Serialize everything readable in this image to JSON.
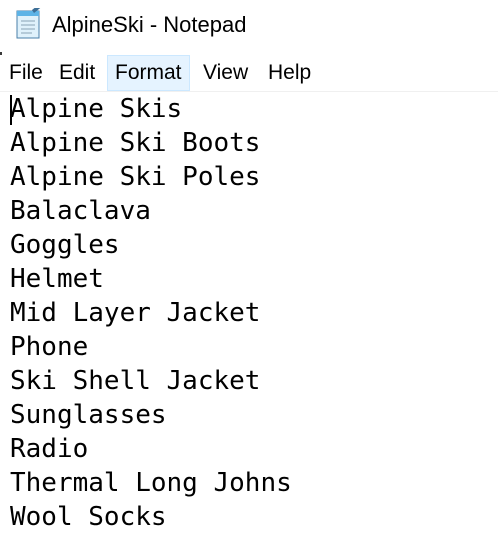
{
  "window": {
    "title": "AlpineSki - Notepad",
    "icon": "notepad-icon"
  },
  "menu": {
    "file": "File",
    "edit": "Edit",
    "format": "Format",
    "view": "View",
    "help": "Help"
  },
  "document": {
    "lines": [
      "Alpine Skis",
      "Alpine Ski Boots",
      "Alpine Ski Poles",
      "Balaclava",
      "Goggles",
      "Helmet",
      "Mid Layer Jacket",
      "Phone",
      "Ski Shell Jacket",
      "Sunglasses",
      "Radio",
      "Thermal Long Johns",
      "Wool Socks"
    ]
  },
  "colors": {
    "menu_highlight": "#e5f3ff",
    "menu_highlight_border": "#cce8ff"
  }
}
